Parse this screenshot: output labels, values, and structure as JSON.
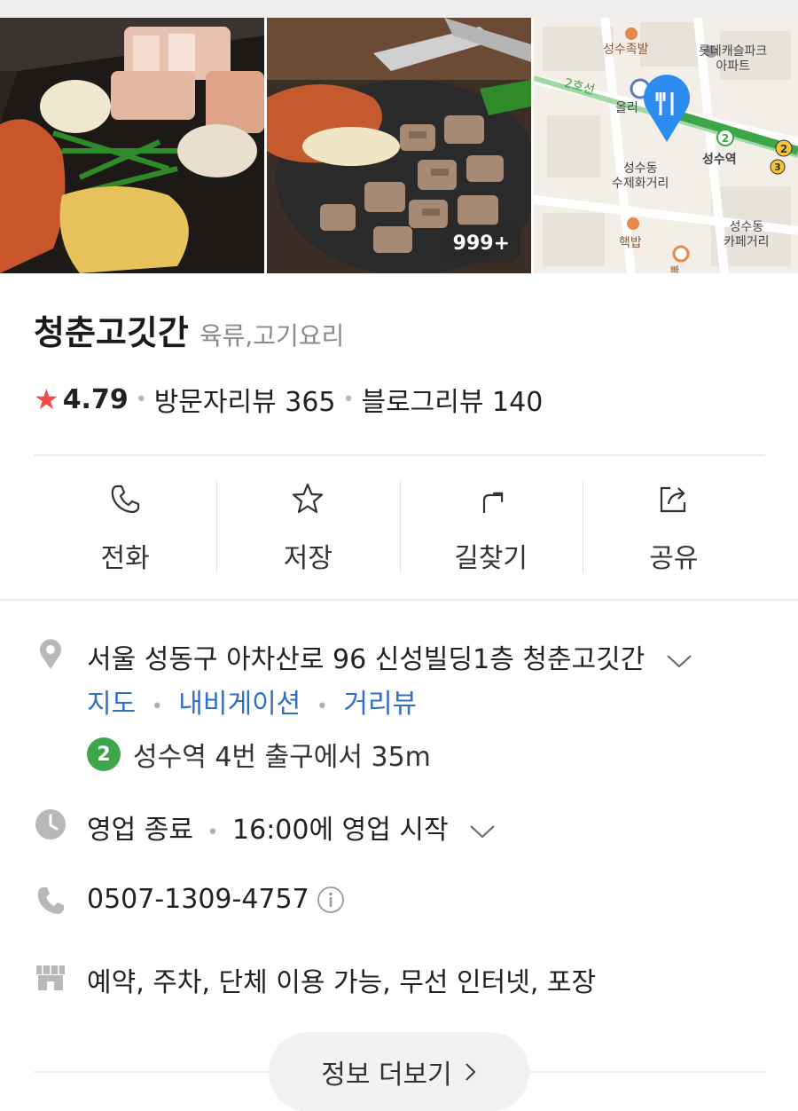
{
  "photos": {
    "count_badge": "999+"
  },
  "map": {
    "labels": {
      "jokbal": "성수족발",
      "lotte": "롯데캐슬파크\n아파트",
      "line2": "2호선",
      "olive": "올리",
      "station": "성수역",
      "sujehwa": "성수동\n수제화거리",
      "cafe": "성수동\n카페거리",
      "hatbap": "핵밥",
      "bottom": "빠"
    }
  },
  "place": {
    "name": "청춘고깃간",
    "category": "육류,고기요리",
    "rating": "4.79",
    "visitor_reviews": "방문자리뷰 365",
    "blog_reviews": "블로그리뷰 140"
  },
  "actions": [
    {
      "label": "전화",
      "icon": "phone-icon"
    },
    {
      "label": "저장",
      "icon": "star-icon"
    },
    {
      "label": "길찾기",
      "icon": "directions-icon"
    },
    {
      "label": "공유",
      "icon": "share-icon"
    }
  ],
  "info": {
    "address": "서울 성동구 아차산로 96 신성빌딩1층 청춘고깃간",
    "links": {
      "map": "지도",
      "navigation": "내비게이션",
      "street_view": "거리뷰"
    },
    "subway_line": "2",
    "subway_text": "성수역 4번 출구에서 35m",
    "hours_status": "영업 종료",
    "hours_next": "16:00에 영업 시작",
    "phone": "0507-1309-4757",
    "amenities": "예약, 주차, 단체 이용 가능, 무선 인터넷, 포장"
  },
  "more_button": "정보 더보기",
  "colors": {
    "star": "#ef4b4b",
    "link": "#2f6fc6",
    "subway_line2": "#3ea64a",
    "map_marker": "#2d8cf0"
  }
}
